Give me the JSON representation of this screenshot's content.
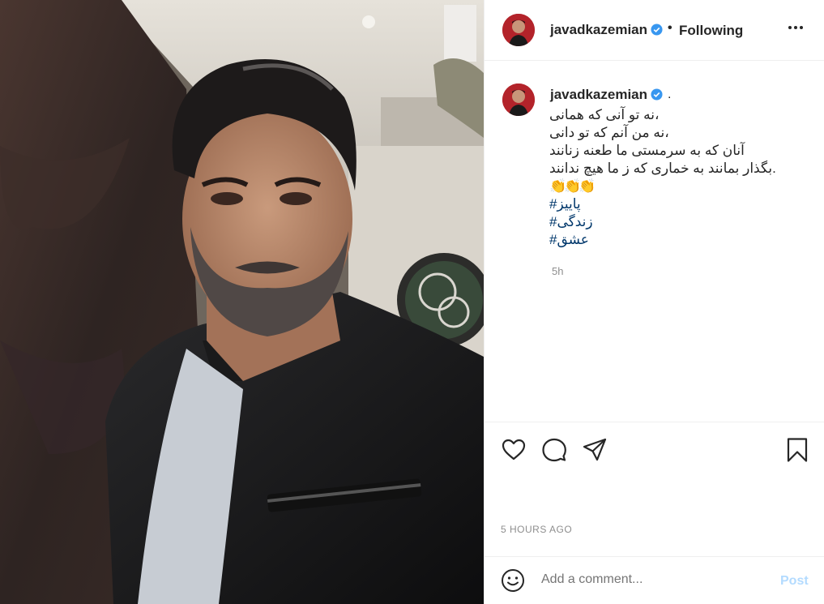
{
  "post": {
    "username": "javadkazemian",
    "follow_status": "Following",
    "caption_tail": ".",
    "caption_lines": [
      "نه تو آنی که همانی،",
      "نه من آنم که تو دانی،",
      "آنان که به سرمستی ما طعنه زنانند",
      "بگذار بمانند به خماری که ز ما هیچ ندانند."
    ],
    "emojis": "👏👏👏",
    "hashtags": [
      "#پاییز",
      "#زندگی",
      "#عشق"
    ],
    "relative_time": "5h",
    "timestamp": "5 HOURS AGO"
  },
  "composer": {
    "placeholder": "Add a comment...",
    "post_label": "Post"
  },
  "icons": {
    "verified": "verified-badge-icon",
    "more": "more-options-icon",
    "like": "heart-icon",
    "comment": "comment-bubble-icon",
    "share": "paper-plane-icon",
    "save": "bookmark-icon",
    "emoji": "smiley-icon"
  },
  "colors": {
    "accent_blue": "#0095f6",
    "hashtag": "#00376b",
    "muted": "#8e8e8e",
    "post_disabled": "#b3dbff"
  }
}
